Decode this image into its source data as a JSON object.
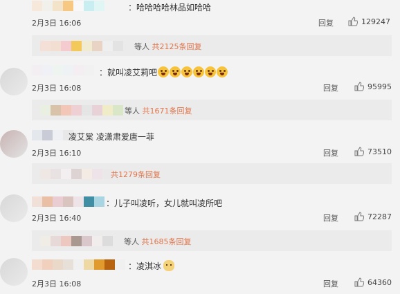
{
  "comments": [
    {
      "text": "：哈哈哈哈林品如哈哈",
      "time": "2月3日 16:06",
      "reply_label": "回复",
      "likes": "129247",
      "replies_summary": {
        "deng": "等人",
        "count": "共2125条回复"
      }
    },
    {
      "text": "：就叫凌艾莉吧",
      "time": "2月3日 16:08",
      "reply_label": "回复",
      "likes": "95995",
      "replies_summary": {
        "deng": "等人",
        "count": "共1671条回复"
      }
    },
    {
      "text": "凌艾棠   凌潇肃爱唐一菲",
      "time": "2月3日 16:10",
      "reply_label": "回复",
      "likes": "73510",
      "replies_summary": {
        "deng": "",
        "count": "共1279条回复"
      }
    },
    {
      "text": "：儿子叫凌听，女儿就叫凌所吧",
      "time": "2月3日 16:40",
      "reply_label": "回复",
      "likes": "72287",
      "replies_summary": {
        "deng": "等人",
        "count": "共1685条回复"
      }
    },
    {
      "text": "：凌淇冰",
      "time": "2月3日 16:08",
      "reply_label": "回复",
      "likes": "64360"
    }
  ],
  "colors": {
    "accent": "#e0744b",
    "background": "#f3f3f3",
    "reply_box": "#ebebeb"
  },
  "icons": {
    "like": "thumbs-up-icon",
    "emoji": "surprised-face-emoji-icon",
    "cat": "cat-emoji-icon"
  }
}
